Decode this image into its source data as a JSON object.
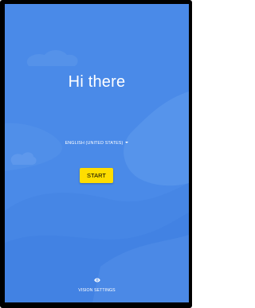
{
  "welcome": {
    "greeting": "Hi there",
    "language_selector": {
      "selected": "ENGLISH (UNITED STATES)",
      "icon": "caret-down-icon"
    },
    "start_label": "START",
    "vision_settings": {
      "label": "VISION SETTINGS",
      "icon": "eye-icon"
    }
  },
  "colors": {
    "background": "#4a8ae8",
    "start_button": "#ffdd00",
    "text": "#ffffff"
  }
}
